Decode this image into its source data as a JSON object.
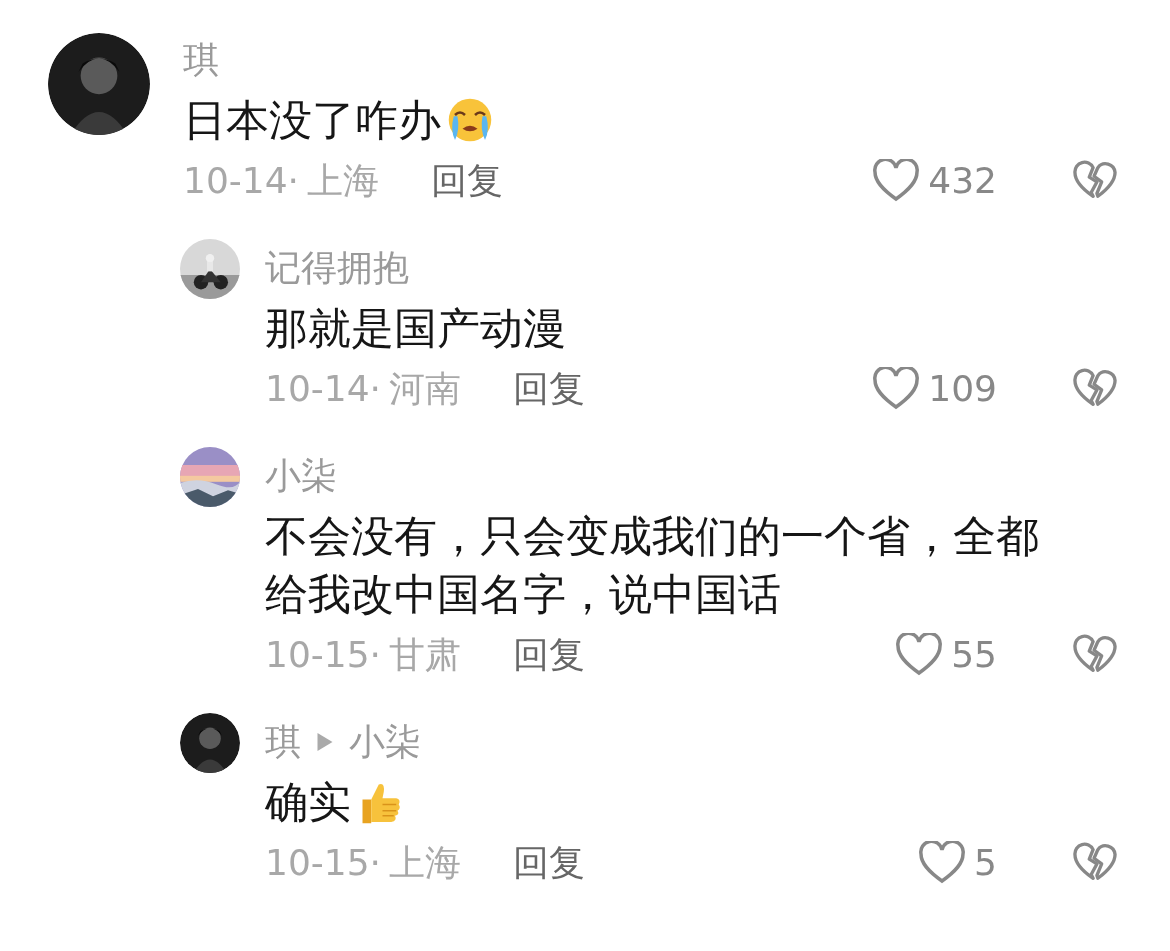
{
  "comments": [
    {
      "kind": "top",
      "name": "琪",
      "text": "日本没了咋办",
      "date": "10-14·",
      "location": "上海",
      "reply_label": "回复",
      "likes": "432"
    },
    {
      "kind": "reply",
      "name": "记得拥抱",
      "text": "那就是国产动漫",
      "date": "10-14·",
      "location": "河南",
      "reply_label": "回复",
      "likes": "109"
    },
    {
      "kind": "reply",
      "name": "小柒",
      "text": "不会没有，只会变成我们的一个省，全都给我改中国名字，说中国话",
      "date": "10-15·",
      "location": "甘肃",
      "reply_label": "回复",
      "likes": "55"
    },
    {
      "kind": "reply",
      "name": "琪",
      "reply_to": "小柒",
      "text": "确实",
      "date": "10-15·",
      "location": "上海",
      "reply_label": "回复",
      "likes": "5"
    }
  ]
}
